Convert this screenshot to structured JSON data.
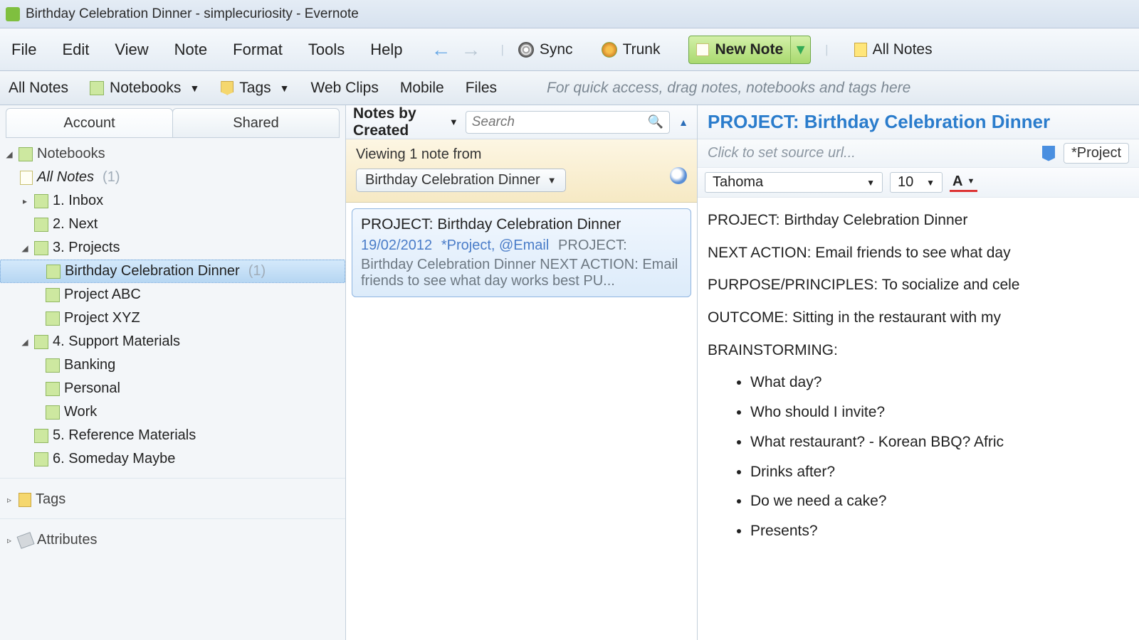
{
  "titlebar": "Birthday Celebration Dinner - simplecuriosity - Evernote",
  "menu": {
    "file": "File",
    "edit": "Edit",
    "view": "View",
    "note": "Note",
    "format": "Format",
    "tools": "Tools",
    "help": "Help"
  },
  "toolbar": {
    "sync": "Sync",
    "trunk": "Trunk",
    "newnote": "New Note",
    "allnotes": "All Notes"
  },
  "secbar": {
    "allnotes": "All Notes",
    "notebooks": "Notebooks",
    "tags": "Tags",
    "webclips": "Web Clips",
    "mobile": "Mobile",
    "files": "Files",
    "hint": "For quick access, drag notes, notebooks and tags here"
  },
  "leftTabs": {
    "account": "Account",
    "shared": "Shared"
  },
  "tree": {
    "notebooks": "Notebooks",
    "allnotes": "All Notes",
    "allnotes_cnt": "(1)",
    "inbox": "1. Inbox",
    "next": "2. Next",
    "projects": "3. Projects",
    "proj_a": "Birthday Celebration Dinner",
    "proj_a_cnt": "(1)",
    "proj_b": "Project ABC",
    "proj_c": "Project XYZ",
    "support": "4. Support Materials",
    "sup_a": "Banking",
    "sup_b": "Personal",
    "sup_c": "Work",
    "reference": "5. Reference Materials",
    "someday": "6. Someday Maybe",
    "tags": "Tags",
    "attributes": "Attributes"
  },
  "mid": {
    "sort": "Notes by Created",
    "search_ph": "Search",
    "viewing": "Viewing 1 note from",
    "nb": "Birthday Celebration Dinner",
    "card_title": "PROJECT: Birthday Celebration Dinner",
    "card_date": "19/02/2012",
    "card_tags": "*Project, @Email",
    "card_body1": "PROJECT:",
    "card_body2": "Birthday Celebration Dinner NEXT ACTION: Email friends to see what day works best PU..."
  },
  "right": {
    "title": "PROJECT: Birthday Celebration Dinner",
    "url_ph": "Click to set source url...",
    "proj_chip": "*Project",
    "font": "Tahoma",
    "size": "10",
    "l1": "PROJECT: Birthday Celebration Dinner",
    "l2": "NEXT ACTION: Email friends to see what day",
    "l3": "PURPOSE/PRINCIPLES: To socialize and cele",
    "l4": "OUTCOME: Sitting in the restaurant with my",
    "l5": "BRAINSTORMING:",
    "b1": "What day?",
    "b2": "Who should I invite?",
    "b3": "What restaurant? - Korean BBQ? Afric",
    "b4": "Drinks after?",
    "b5": "Do we need a cake?",
    "b6": "Presents?"
  }
}
